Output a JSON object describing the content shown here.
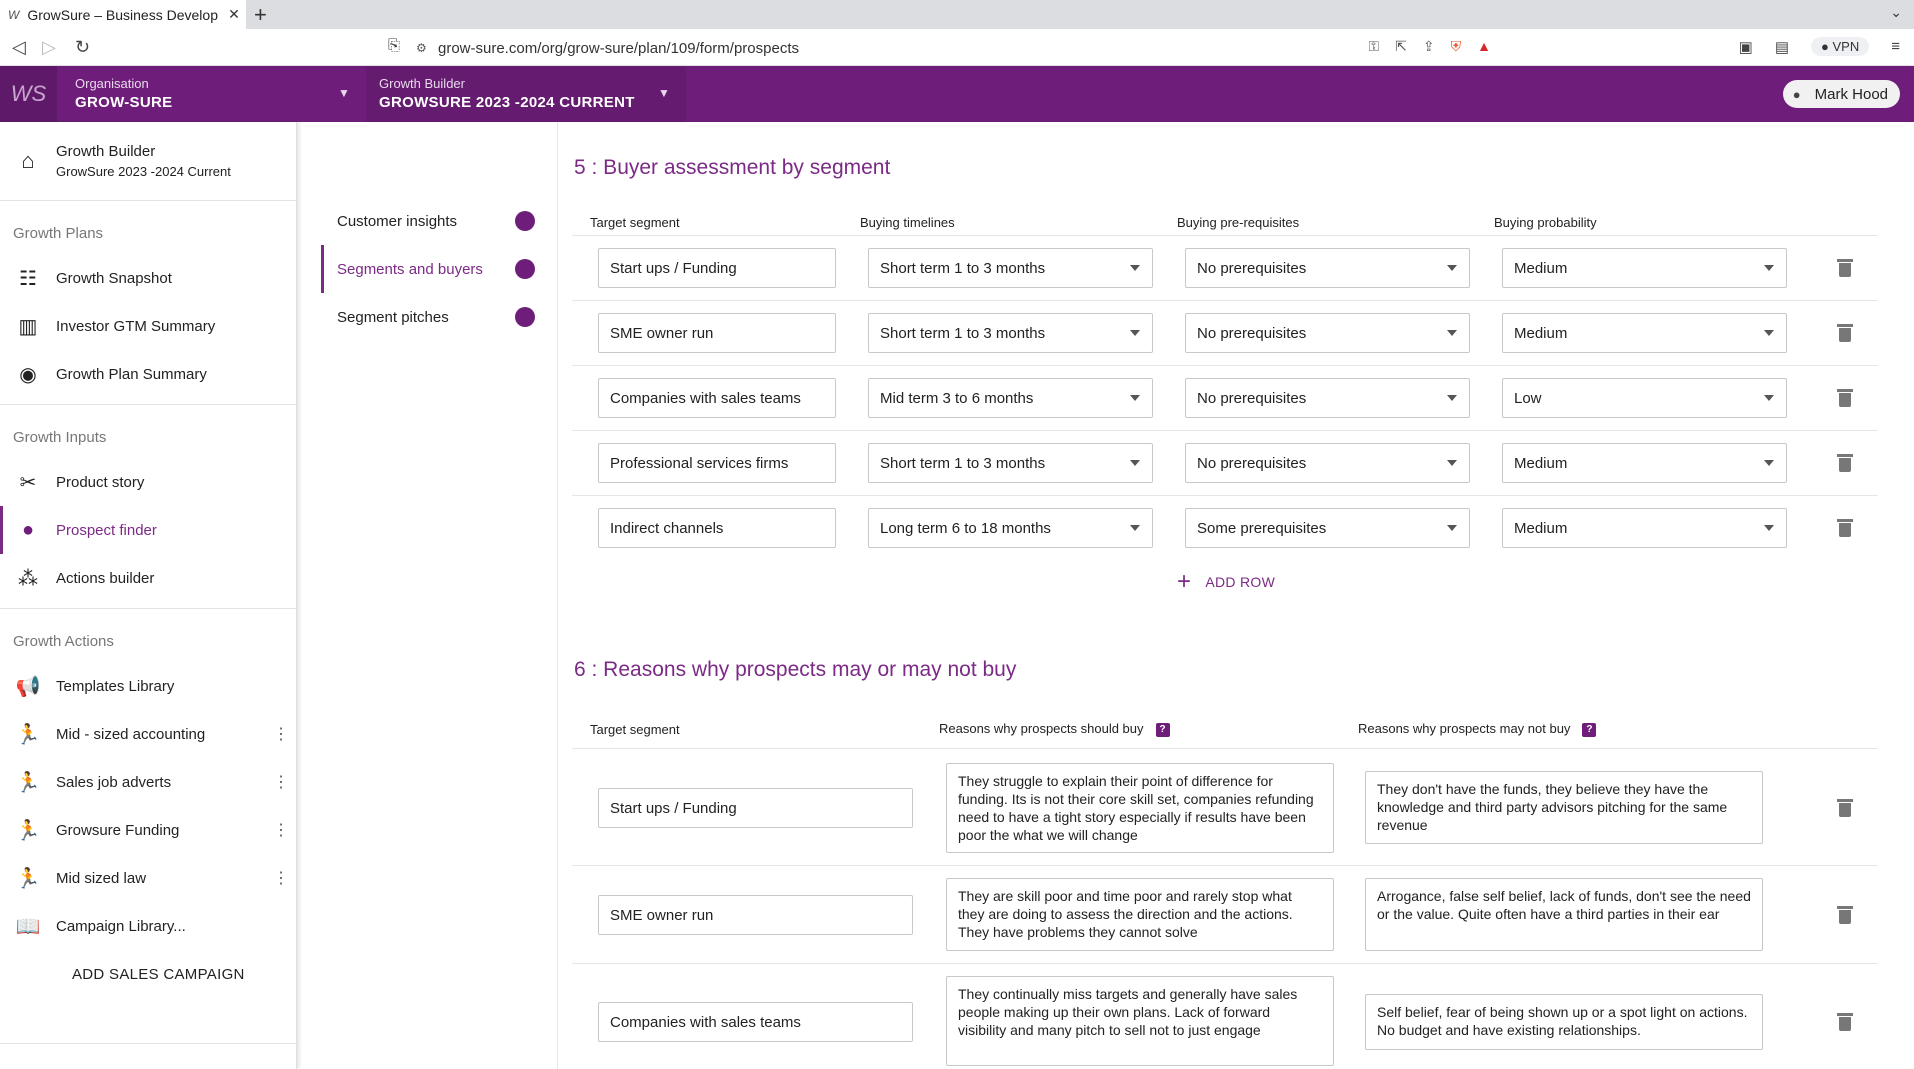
{
  "browser": {
    "tab_title": "GrowSure – Business Develop",
    "url": "grow-sure.com/org/grow-sure/plan/109/form/prospects",
    "vpn_label": "VPN"
  },
  "header": {
    "logo_text": "WS",
    "org_label": "Organisation",
    "org_value": "GROW-SURE",
    "builder_label": "Growth Builder",
    "builder_value": "GROWSURE 2023 -2024 CURRENT",
    "user_name": "Mark Hood"
  },
  "sidebar": {
    "top_title": "Growth Builder",
    "top_subtitle": "GrowSure 2023 -2024 Current",
    "plans_title": "Growth Plans",
    "plans": [
      {
        "label": "Growth Snapshot",
        "icon": "checklist-icon"
      },
      {
        "label": "Investor GTM Summary",
        "icon": "bar-chart-icon"
      },
      {
        "label": "Growth Plan Summary",
        "icon": "camera-icon"
      }
    ],
    "inputs_title": "Growth Inputs",
    "inputs": [
      {
        "label": "Product story",
        "icon": "tools-icon"
      },
      {
        "label": "Prospect finder",
        "icon": "person-icon"
      },
      {
        "label": "Actions builder",
        "icon": "group-icon"
      }
    ],
    "actions_title": "Growth Actions",
    "actions": [
      {
        "label": "Templates Library",
        "icon": "megaphone-icon"
      },
      {
        "label": "Mid - sized accounting",
        "icon": "runner-icon"
      },
      {
        "label": "Sales job adverts",
        "icon": "runner-icon"
      },
      {
        "label": "Growsure Funding",
        "icon": "runner-icon"
      },
      {
        "label": "Mid sized law",
        "icon": "runner-icon"
      },
      {
        "label": "Campaign Library...",
        "icon": "book-icon"
      }
    ],
    "add_campaign": "ADD SALES CAMPAIGN"
  },
  "section_nav": [
    {
      "label": "Customer insights"
    },
    {
      "label": "Segments and buyers"
    },
    {
      "label": "Segment pitches"
    }
  ],
  "buyer_assessment": {
    "title": "5 : Buyer assessment by segment",
    "headers": {
      "segment": "Target segment",
      "timelines": "Buying timelines",
      "prereq": "Buying pre-requisites",
      "probability": "Buying probability"
    },
    "rows": [
      {
        "segment": "Start ups / Funding",
        "timeline": "Short term 1 to 3 months",
        "prereq": "No prerequisites",
        "probability": "Medium"
      },
      {
        "segment": "SME owner run",
        "timeline": "Short term 1 to 3 months",
        "prereq": "No prerequisites",
        "probability": "Medium"
      },
      {
        "segment": "Companies with sales teams",
        "timeline": "Mid term 3 to 6 months",
        "prereq": "No prerequisites",
        "probability": "Low"
      },
      {
        "segment": "Professional services firms",
        "timeline": "Short term 1 to 3 months",
        "prereq": "No prerequisites",
        "probability": "Medium"
      },
      {
        "segment": "Indirect channels",
        "timeline": "Long term 6 to 18 months",
        "prereq": "Some prerequisites",
        "probability": "Medium"
      }
    ],
    "add_row": "ADD ROW"
  },
  "reasons": {
    "title": "6 : Reasons why prospects may or may not buy",
    "headers": {
      "segment": "Target segment",
      "should_buy": "Reasons why prospects should buy",
      "may_not_buy": "Reasons why prospects may not buy"
    },
    "help_glyph": "?",
    "rows": [
      {
        "segment": "Start ups / Funding",
        "should_buy": "They struggle to explain their point of difference for funding. Its is not their core skill set, companies refunding need to have a tight story especially if results have been poor the what we will change",
        "may_not_buy": "They don't have the funds, they believe they have the knowledge and third party advisors pitching for the same revenue"
      },
      {
        "segment": "SME owner run",
        "should_buy": "They are skill poor and time poor and rarely stop what they are doing to assess the direction and the actions. They have problems they cannot solve",
        "may_not_buy": "Arrogance, false self belief, lack of funds, don't see the need or the value. Quite often have a third parties in their ear"
      },
      {
        "segment": "Companies with sales teams",
        "should_buy": "They continually miss targets and generally have sales people making up their own plans. Lack of forward visibility and many pitch to sell not to just engage",
        "may_not_buy": "Self belief, fear of being shown up or a spot light on actions. No budget and have existing relationships."
      }
    ]
  },
  "colors": {
    "brand": "#6e1e7a",
    "accent_text": "#7b2a85"
  }
}
